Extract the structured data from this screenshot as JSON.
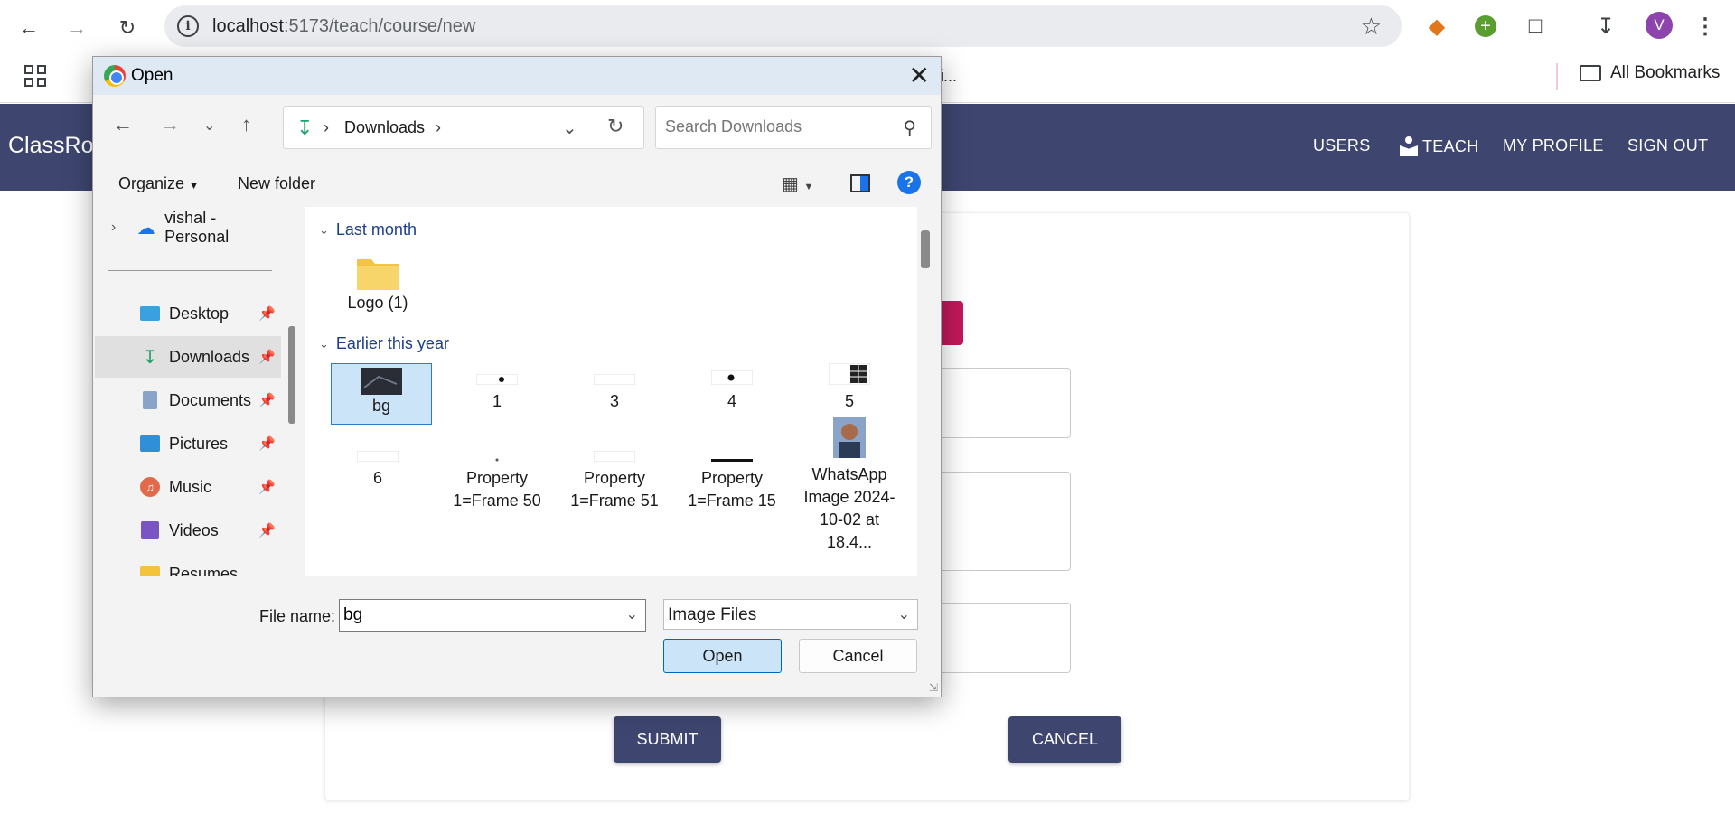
{
  "browser": {
    "url_host": "localhost",
    "url_path": ":5173/teach/course/new",
    "avatar_letter": "V",
    "bookmark_truncated": "i...",
    "all_bookmarks": "All Bookmarks"
  },
  "app": {
    "brand": "ClassRo",
    "nav": {
      "users": "USERS",
      "teach": "TEACH",
      "profile": "MY PROFILE",
      "signout": "SIGN OUT"
    },
    "submit": "SUBMIT",
    "cancel": "CANCEL"
  },
  "dialog": {
    "title": "Open",
    "breadcrumb": "Downloads",
    "search_placeholder": "Search Downloads",
    "organize": "Organize",
    "new_folder": "New folder",
    "help": "?",
    "sidebar": [
      {
        "label": "vishal - Personal",
        "icon": "cloud-icon"
      },
      {
        "label": "Desktop",
        "icon": "desktop-icon"
      },
      {
        "label": "Downloads",
        "icon": "download-icon"
      },
      {
        "label": "Documents",
        "icon": "documents-icon"
      },
      {
        "label": "Pictures",
        "icon": "pictures-icon"
      },
      {
        "label": "Music",
        "icon": "music-icon"
      },
      {
        "label": "Videos",
        "icon": "videos-icon"
      },
      {
        "label": "Resumes",
        "icon": "folder-icon"
      }
    ],
    "groups": [
      {
        "label": "Last month"
      },
      {
        "label": "Earlier this year"
      }
    ],
    "files": [
      {
        "label": "Logo (1)"
      },
      {
        "label": "bg"
      },
      {
        "label": "1"
      },
      {
        "label": "3"
      },
      {
        "label": "4"
      },
      {
        "label": "5"
      },
      {
        "label": "6"
      },
      {
        "label": "Property 1=Frame 50"
      },
      {
        "label": "Property 1=Frame 51"
      },
      {
        "label": "Property 1=Frame 15"
      },
      {
        "label": "WhatsApp Image 2024-10-02 at 18.4..."
      }
    ],
    "file_name_label": "File name:",
    "file_name_value": "bg",
    "file_type": "Image Files",
    "open": "Open",
    "cancel": "Cancel"
  }
}
